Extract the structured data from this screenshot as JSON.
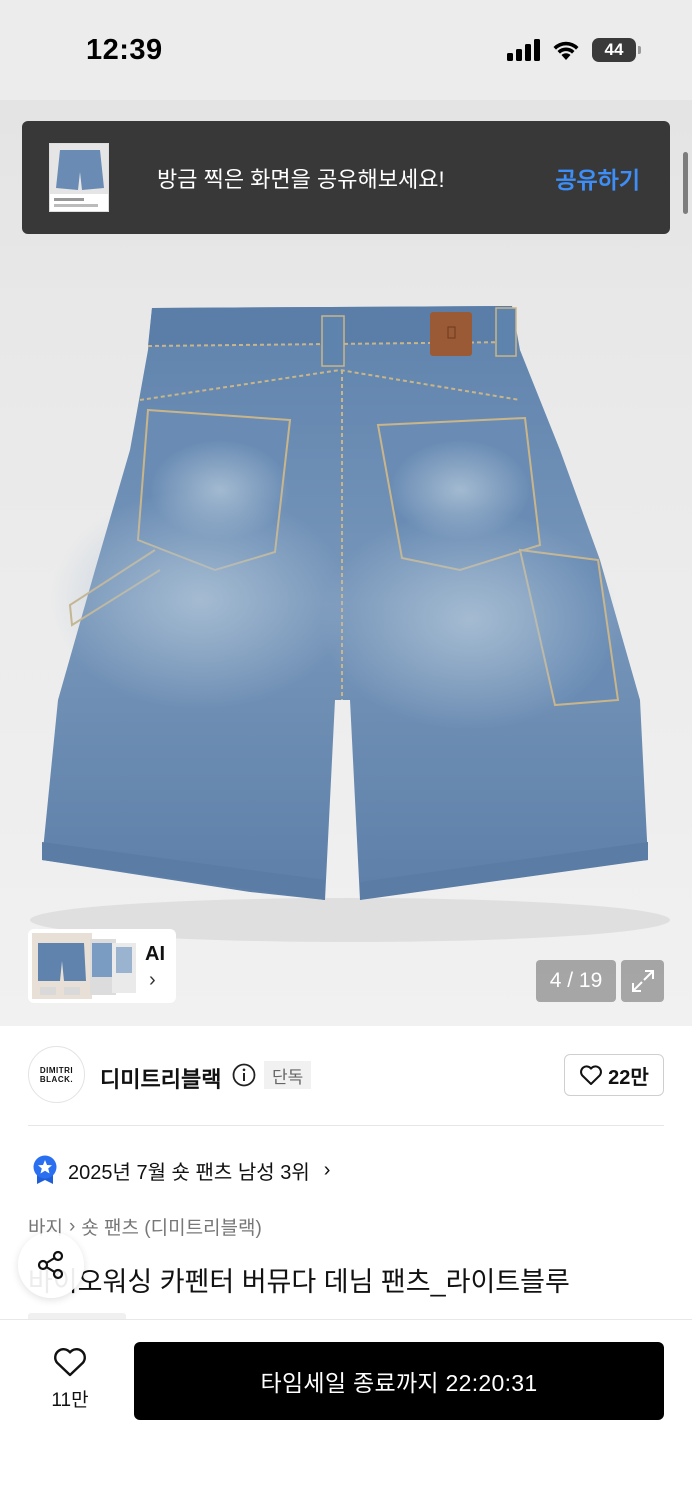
{
  "status_bar": {
    "time": "12:39",
    "battery": "44"
  },
  "toast": {
    "message": "방금 찍은 화면을 공유해보세요!",
    "action": "공유하기"
  },
  "gallery": {
    "ai_label": "AI",
    "ai_chevron": "›",
    "counter": "4 / 19"
  },
  "brand": {
    "logo_line1": "DIMITRI",
    "logo_line2": "BLACK.",
    "name": "디미트리블랙",
    "badge": "단독",
    "likes": "22만"
  },
  "ranking": {
    "text": "2025년 7월 숏 팬츠 남성 3위",
    "chevron": "›"
  },
  "breadcrumb": {
    "level1": "바지",
    "separator": "›",
    "level2": "숏 팬츠 (디미트리블랙)"
  },
  "product": {
    "title": "바이오워싱 카펜터 버뮤다 데님 팬츠_라이트블루"
  },
  "bottom_bar": {
    "wish_count": "11만",
    "buy_label": "타임세일 종료까지 22:20:31"
  },
  "colors": {
    "accent": "#3e8ef7",
    "buy_button": "#000000",
    "toast_bg": "#383838",
    "denim": "#6a8cb4"
  },
  "icons": [
    "signal-icon",
    "wifi-icon",
    "battery-icon",
    "info-icon",
    "heart-icon",
    "star-badge-icon",
    "share-icon",
    "expand-icon",
    "chevron-right-icon"
  ]
}
